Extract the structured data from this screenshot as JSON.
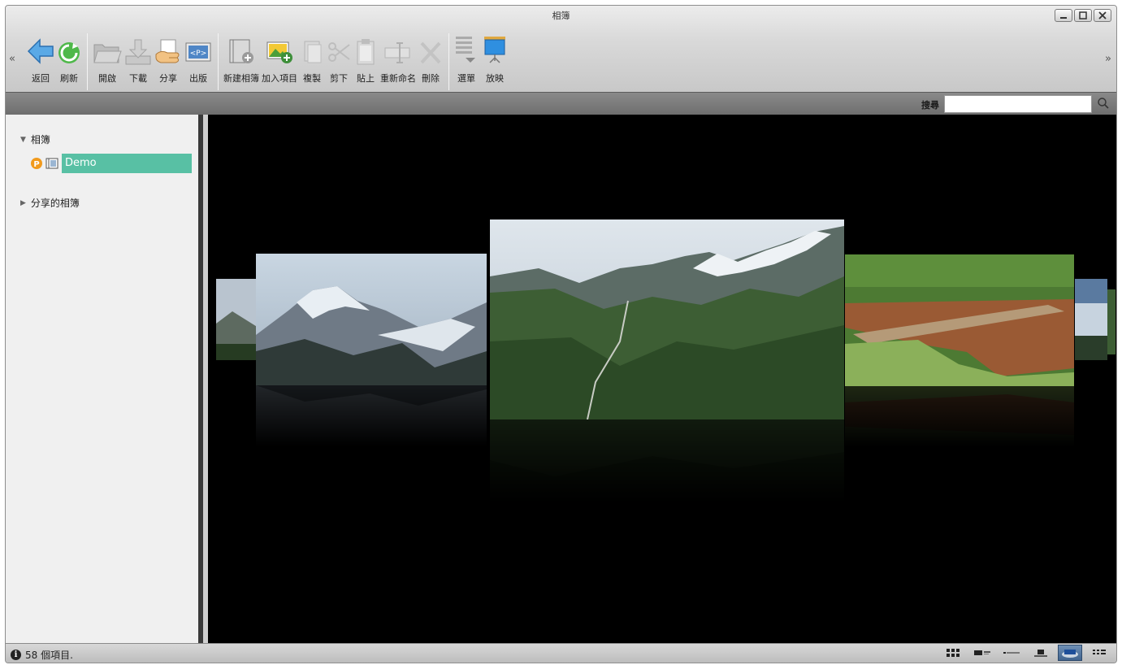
{
  "window": {
    "title": "相簿"
  },
  "toolbar": {
    "back": "返回",
    "refresh": "刷新",
    "open": "開啟",
    "download": "下載",
    "share": "分享",
    "publish": "出版",
    "new_album": "新建相簿",
    "add_item": "加入項目",
    "copy": "複製",
    "cut": "剪下",
    "paste": "貼上",
    "rename": "重新命名",
    "delete": "刪除",
    "menu": "選單",
    "slideshow": "放映",
    "left_chevron": "«",
    "right_chevron": "»"
  },
  "search": {
    "label": "搜尋",
    "value": ""
  },
  "sidebar": {
    "albums_label": "相簿",
    "demo_label": "Demo",
    "shared_label": "分享的相簿"
  },
  "status": {
    "text": "58 個項目."
  },
  "colors": {
    "selection": "#58c0a4",
    "viewer_bg": "#000000"
  }
}
